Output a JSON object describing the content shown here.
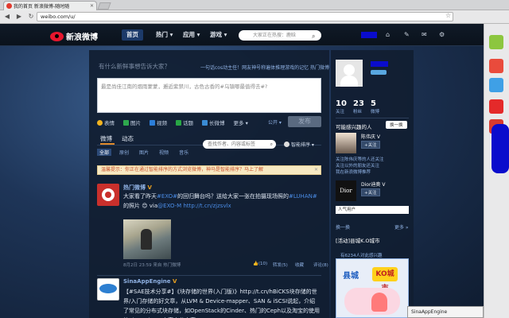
{
  "browser": {
    "tab_title": "我的首页 新浪微博-随时随",
    "url": "weibo.com/u/",
    "extensions": [
      "puzzle-icon",
      "camera-icon",
      "speaker-icon",
      "wrench-icon"
    ]
  },
  "nav": {
    "logo_text": "新浪微博",
    "items": [
      "首页",
      "热门 ▾",
      "应用 ▾",
      "游戏 ▾"
    ],
    "search_placeholder": "大家正在热搜：鹿晗"
  },
  "publisher": {
    "heading": "有什么新鲜事想告诉大家？",
    "hint": "一句话cos动主任！网友神号称遍体推理游戏的记忆",
    "hot_link": "热门微博",
    "textarea_text": "最是尚佳江南的烟雨蒙蒙，邂逅紫禁川，古色古香的#乌镇哪最值得去#?",
    "tools": [
      {
        "label": "表情",
        "color": "#f2b320"
      },
      {
        "label": "图片",
        "color": "#2ea84d"
      },
      {
        "label": "视频",
        "color": "#2c7ed8"
      },
      {
        "label": "话题",
        "color": "#28a745"
      },
      {
        "label": "长微博",
        "color": "#3a8bd4"
      },
      {
        "label": "更多 ▾",
        "color": ""
      }
    ],
    "public_label": "公开 ▾",
    "send_label": "发布"
  },
  "feed_tabs": [
    "微博",
    "动态"
  ],
  "sub_tabs": [
    "全部",
    "原创",
    "图片",
    "视频",
    "音乐"
  ],
  "filter_search_placeholder": "查找作者、内容或标签",
  "smart_sort": "智能排序 ▾",
  "notice": "温馨提示：你正在通过智能排序的方式浏览微博，神马是智能排序？马上了解",
  "feeds": [
    {
      "author": "热门微博",
      "badge": "V",
      "text_plain": "大家看了昨天",
      "text_link1": "#EXO#",
      "text_mid": "的回归舞台吗？送给大家一张在拍摄现场照的",
      "text_link2": "#LUHAN#",
      "text_end": "的照片",
      "via_prefix": "via",
      "via_link": "@EXO-M",
      "url": "http://t.cn/zjzsvlx",
      "meta": "8月2日 23:59  来自 热门微博",
      "actions": [
        "👍(10)",
        "转发(5)",
        "收藏",
        "评论(8)"
      ]
    },
    {
      "author": "SinaAppEngine",
      "badge": "V",
      "text": "【#SAE技术分享#】《块存储的世界(入门版)》http://t.cn/hBiCKS块存储的世界/入门存储的好文章，从LVM & Device-mapper、SAN & iSCSI说起，介绍了常见的分布式块存储，如OpenStack的Cinder、热门的Ceph以及淘宝的使用的Sheepdog，内容十分丰富"
    }
  ],
  "sidebar": {
    "stats": [
      {
        "n": "10",
        "l": "关注"
      },
      {
        "n": "23",
        "l": "粉丝"
      },
      {
        "n": "5",
        "l": "微博"
      }
    ],
    "interest_heading": "可能感兴趣的人",
    "change_label": "换一换",
    "suggestions": [
      {
        "name": "陈伟庆 V",
        "follow": "+关注",
        "desc": "关注陈伟庆等的人还关注\n关注以外的朋友还关注\n我在新浪微博推荐"
      },
      {
        "name": "Dior迪奥 V",
        "follow": "+关注",
        "desc": "人气用户"
      }
    ],
    "topic_more": "换一换",
    "ad_label": "推荐",
    "ad_more": "更多 »",
    "city_heading": "[活动]县城K.O城市",
    "city_sub": "有6234人对此感兴趣",
    "city_title": "县城",
    "city_ko": "KO城市",
    "city_bar": "测试一下你的老家KO了"
  },
  "popup": "SinaAppEngine"
}
